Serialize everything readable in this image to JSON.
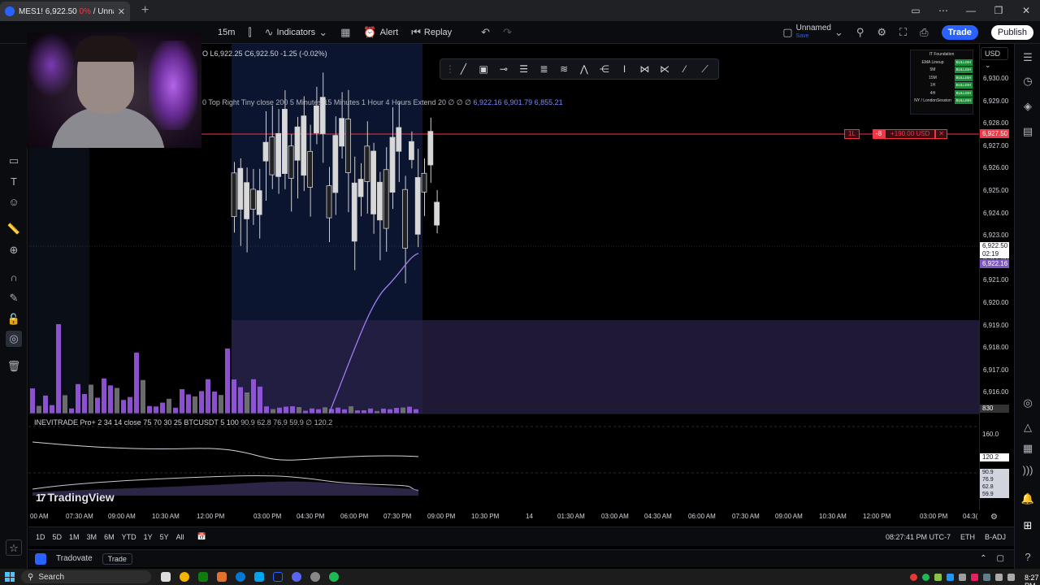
{
  "browser": {
    "tab_title_symbol": "MES1! 6,922.50",
    "tab_title_change": "0%",
    "tab_title_rest": "/ Unna...",
    "tab_close": "✕",
    "new_tab": "+"
  },
  "toolbar": {
    "symbol": "MES1!",
    "interval": "15m",
    "indicators": "Indicators",
    "alert": "Alert",
    "replay": "Replay",
    "layout_name": "Unnamed",
    "layout_sub": "Save",
    "trade": "Trade",
    "publish": "Publish"
  },
  "legend": {
    "ohlc": "O  L6,922.25 C6,922.50 -1.25 (-0.02%)",
    "indicator_line": "0 Top Right Tiny close 200 5 Minutes 15 Minutes 1 Hour 4 Hours Extend 20  ∅ ∅ ∅",
    "indicator_values": "6,922.16  6,901.79  6,855.21",
    "oscillator": "INEVITRADE Pro+ 2 34 14 close 75 70 30 25 BTCUSDT 5 100",
    "oscillator_values": "90.9  62.8  76.9  59.9  ∅  120.2"
  },
  "mini_table": {
    "title": "IT Foundation",
    "rows": [
      {
        "k": "EMA Lineup",
        "v": "BULLISH"
      },
      {
        "k": "5M",
        "v": "BULLISH"
      },
      {
        "k": "15M",
        "v": "BULLISH"
      },
      {
        "k": "1H",
        "v": "BULLISH"
      },
      {
        "k": "4H",
        "v": "BULLISH"
      },
      {
        "k": "NY / LondonSession",
        "v": "BULLISH"
      }
    ]
  },
  "currency": "USD",
  "price_labels": [
    "6,930.00",
    "6,929.00",
    "6,928.00",
    "6,927.00",
    "6,926.00",
    "6,925.00",
    "6,924.00",
    "6,923.00",
    "6,922.00",
    "6,921.00",
    "6,920.00",
    "6,919.00",
    "6,918.00",
    "6,917.00",
    "6,916.00"
  ],
  "price_tags": {
    "position_line": "6,927.50",
    "last_price": "6,922.50",
    "countdown": "02:19",
    "ema": "6,922.16",
    "volume": "830",
    "osc_top": "160.0",
    "osc_last": "120.2",
    "osc_vals": [
      "90.9",
      "76.9",
      "62.8",
      "59.9"
    ]
  },
  "position": {
    "side": "1L",
    "qty": "-8",
    "pnl": "+190.00 USD",
    "close": "✕"
  },
  "time_axis": [
    "00 AM",
    "07:30 AM",
    "09:00 AM",
    "10:30 AM",
    "12:00 PM",
    "03:00 PM",
    "04:30 PM",
    "06:00 PM",
    "07:30 PM",
    "09:00 PM",
    "10:30 PM",
    "14",
    "01:30 AM",
    "03:00 AM",
    "04:30 AM",
    "06:00 AM",
    "07:30 AM",
    "09:00 AM",
    "10:30 AM",
    "12:00 PM",
    "03:00 PM",
    "04:3("
  ],
  "ranges": [
    "1D",
    "5D",
    "1M",
    "3M",
    "6M",
    "YTD",
    "1Y",
    "5Y",
    "All"
  ],
  "status": {
    "clock": "08:27:41 PM UTC-7",
    "session": "ETH",
    "adj": "B-ADJ"
  },
  "panel": {
    "broker": "Tradovate",
    "trade": "Trade"
  },
  "watermark": "TradingView",
  "taskbar": {
    "search": "Search",
    "time": "8:27 PM"
  },
  "colors": {
    "accent": "#2962ff",
    "bear": "#f23645",
    "bull": "#1b8f3a",
    "volume": "#9b59e6",
    "ema": "#a37cf0",
    "zone": "#2a2148"
  }
}
